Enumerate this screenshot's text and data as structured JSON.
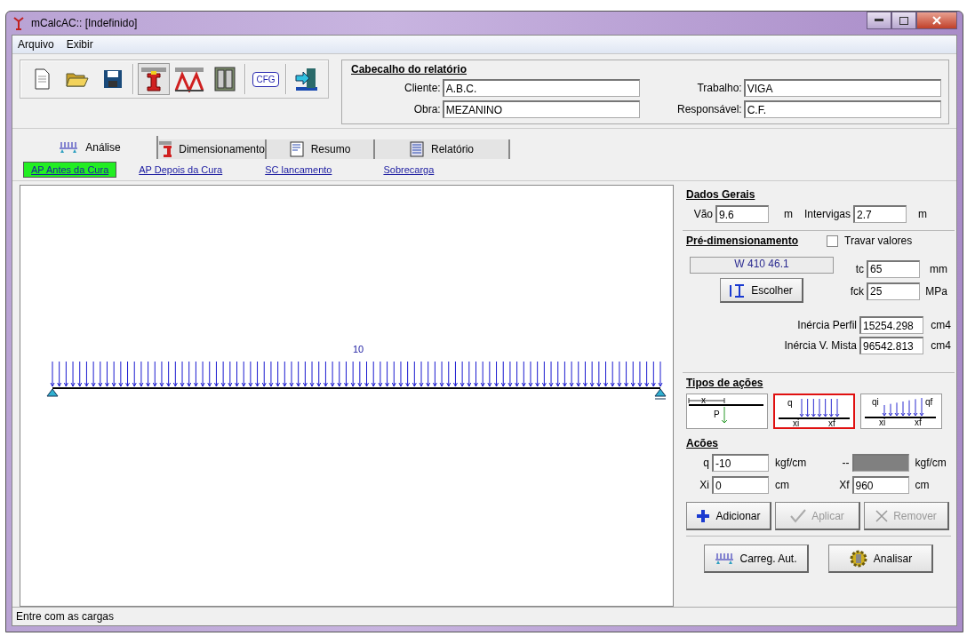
{
  "window": {
    "title": "mCalcAC:: [Indefinido]"
  },
  "menu": [
    {
      "label": "Arquivo"
    },
    {
      "label": "Exibir"
    }
  ],
  "toolbar": [
    {
      "kind": "new",
      "pressed": false
    },
    {
      "kind": "open",
      "pressed": false
    },
    {
      "kind": "save",
      "pressed": false
    },
    {
      "kind": "separator"
    },
    {
      "kind": "beam",
      "pressed": true
    },
    {
      "kind": "truss",
      "pressed": false
    },
    {
      "kind": "panel",
      "pressed": false
    },
    {
      "kind": "separator"
    },
    {
      "kind": "cfg",
      "label": "CFG",
      "pressed": false
    },
    {
      "kind": "separator"
    },
    {
      "kind": "exit",
      "pressed": false
    }
  ],
  "report_header": {
    "title": "Cabecalho do relatório",
    "fields": [
      {
        "label": "Cliente:",
        "value": "A.B.C."
      },
      {
        "label": "Trabalho:",
        "value": "VIGA"
      },
      {
        "label": "Obra:",
        "value": "MEZANINO"
      },
      {
        "label": "Responsável:",
        "value": "C.F."
      }
    ]
  },
  "tabs": [
    {
      "label": "Análise",
      "kind": "loads",
      "selected": true
    },
    {
      "label": "Dimensionamento",
      "kind": "beam",
      "selected": false
    },
    {
      "label": "Resumo",
      "kind": "doc",
      "selected": false
    },
    {
      "label": "Relatório",
      "kind": "report",
      "selected": false
    }
  ],
  "subtabs": [
    {
      "label": "AP Antes da Cura",
      "selected": true
    },
    {
      "label": "AP Depois da Cura",
      "selected": false
    },
    {
      "label": "SC lancamento",
      "selected": false
    },
    {
      "label": "Sobrecarga",
      "selected": false
    }
  ],
  "diagram": {
    "load_label": "10"
  },
  "general": {
    "title": "Dados Gerais",
    "fields": [
      {
        "label": "Vão",
        "value": "9.6",
        "unit": "m"
      },
      {
        "label": "Intervigas",
        "value": "2.7",
        "unit": "m"
      }
    ]
  },
  "predesign": {
    "title": "Pré-dimensionamento",
    "lock": {
      "label": "Travar valores",
      "checked": false
    },
    "profile": "W 410 46.1",
    "choose_button": "Escolher",
    "fields": [
      {
        "label": "tc",
        "value": "65",
        "unit": "mm"
      },
      {
        "label": "fck",
        "value": "25",
        "unit": "MPa"
      }
    ],
    "inertia": [
      {
        "label": "Inércia Perfil",
        "value": "15254.298",
        "unit": "cm4"
      },
      {
        "label": "Inércia V. Mista",
        "value": "96542.813",
        "unit": "cm4"
      }
    ]
  },
  "action_types": {
    "title": "Tipos de ações",
    "items": [
      {
        "kind": "point",
        "labels": [
          "x",
          "P"
        ],
        "selected": false
      },
      {
        "kind": "uniform",
        "labels": [
          "q",
          "xi",
          "xf"
        ],
        "selected": true
      },
      {
        "kind": "linear",
        "labels": [
          "qi",
          "qf",
          "xi",
          "xf"
        ],
        "selected": false
      }
    ]
  },
  "actions": {
    "title": "Acões",
    "fields": [
      {
        "label": "q",
        "value": "-10",
        "unit": "kgf/cm",
        "disabled": false
      },
      {
        "label": "--",
        "unit": "kgf/cm",
        "disabled": true
      },
      {
        "label": "Xi",
        "value": "0",
        "unit": "cm",
        "disabled": false
      },
      {
        "label": "Xf",
        "value": "960",
        "unit": "cm",
        "disabled": false
      }
    ]
  },
  "edit_buttons": [
    {
      "label": "Adicionar",
      "kind": "plus",
      "disabled": false
    },
    {
      "label": "Aplicar",
      "kind": "check",
      "disabled": true
    },
    {
      "label": "Remover",
      "kind": "cross",
      "disabled": true
    }
  ],
  "main_buttons": [
    {
      "label": "Carreg. Aut.",
      "kind": "loads"
    },
    {
      "label": "Analisar",
      "kind": "gear"
    }
  ],
  "status_bar": "Entre com as cargas"
}
